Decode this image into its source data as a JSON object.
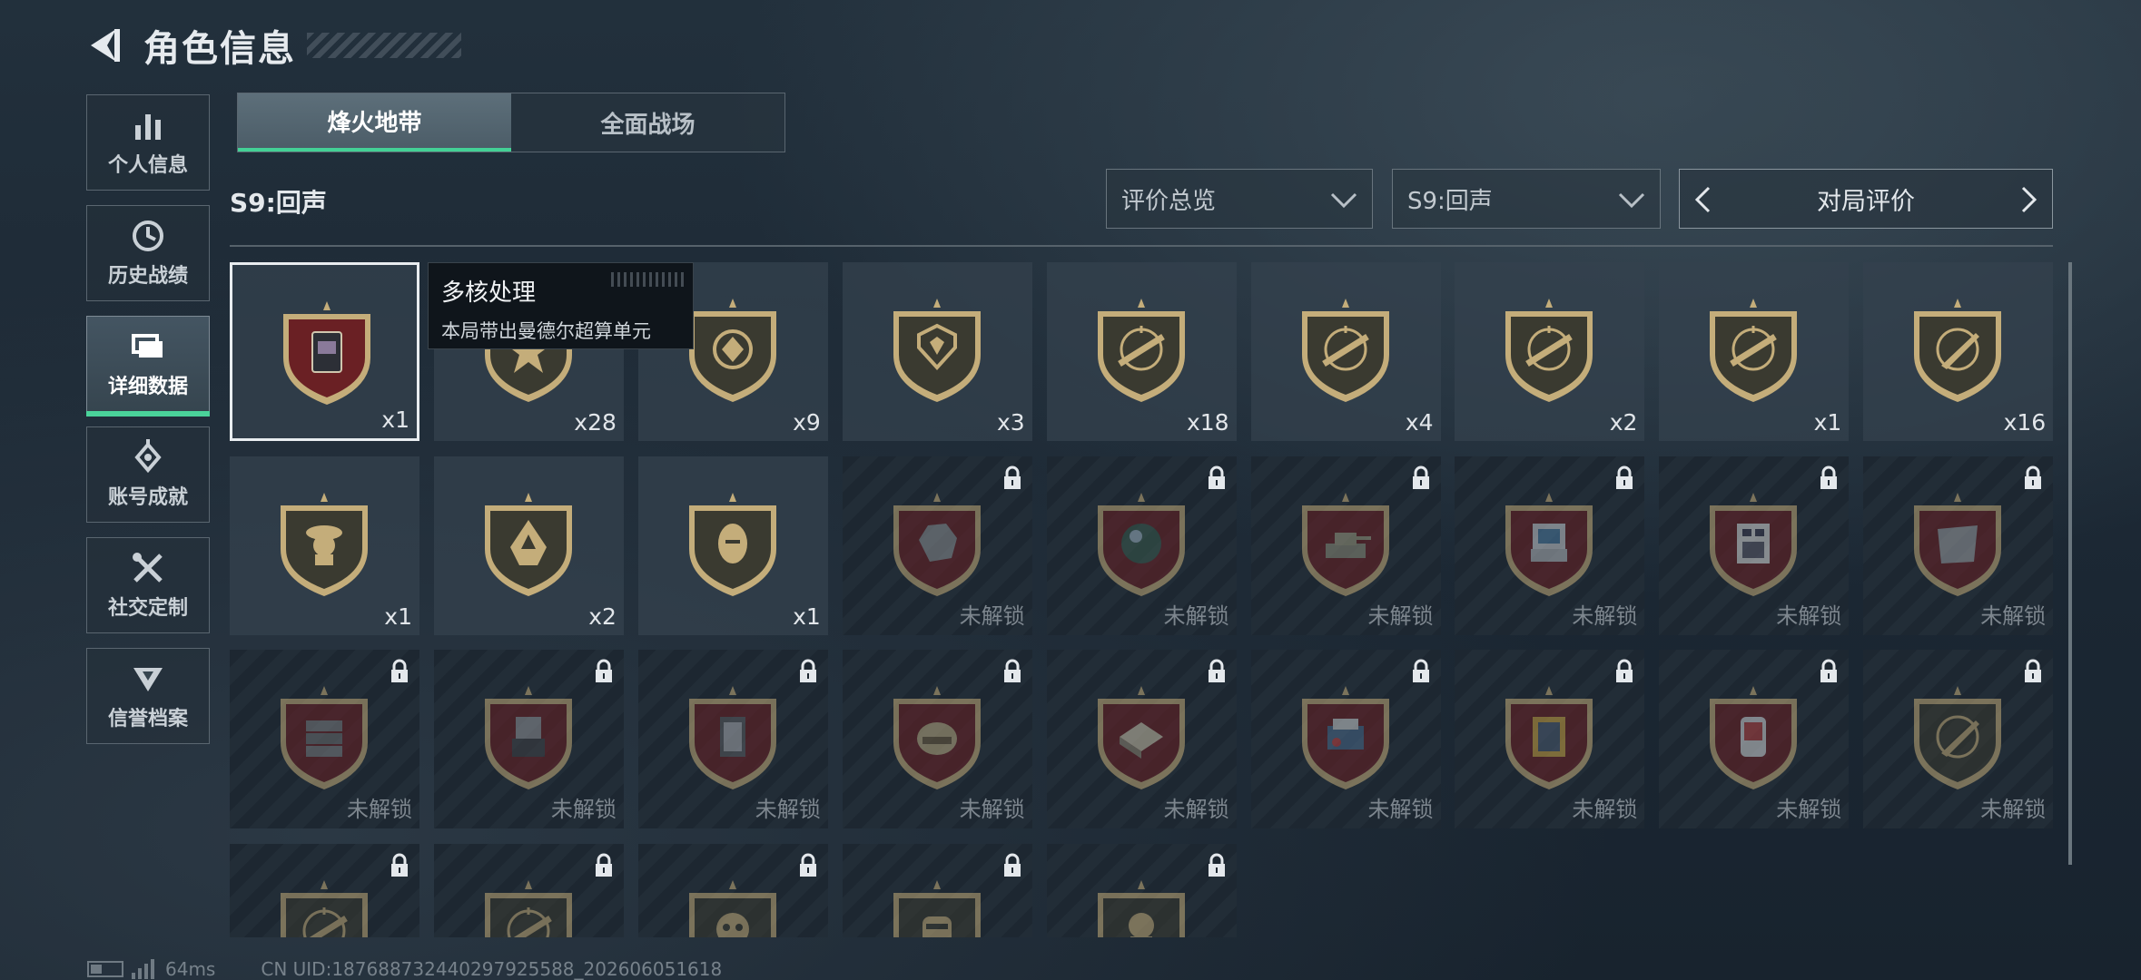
{
  "header": {
    "title": "角色信息"
  },
  "sidebar": {
    "items": [
      {
        "label": "个人信息",
        "icon": "bar-chart-icon",
        "active": false
      },
      {
        "label": "历史战绩",
        "icon": "clock-icon",
        "active": false
      },
      {
        "label": "详细数据",
        "icon": "cards-icon",
        "active": true
      },
      {
        "label": "账号成就",
        "icon": "achievement-icon",
        "active": false
      },
      {
        "label": "社交定制",
        "icon": "tools-icon",
        "active": false
      },
      {
        "label": "信誉档案",
        "icon": "reputation-icon",
        "active": false
      }
    ]
  },
  "tabs": [
    {
      "label": "烽火地带",
      "active": true
    },
    {
      "label": "全面战场",
      "active": false
    }
  ],
  "season_label": "S9:回声",
  "filters": {
    "overview": "评价总览",
    "season": "S9:回声",
    "pager_label": "对局评价"
  },
  "tooltip": {
    "title": "多核处理",
    "desc": "本局带出曼德尔超算单元"
  },
  "locked_label": "未解锁",
  "badges": [
    {
      "type": "computer",
      "count": "x1",
      "locked": false,
      "selected": true
    },
    {
      "type": "star",
      "count": "x28",
      "locked": false
    },
    {
      "type": "emblem",
      "count": "x9",
      "locked": false
    },
    {
      "type": "chevron",
      "count": "x3",
      "locked": false
    },
    {
      "type": "rifle",
      "count": "x18",
      "locked": false
    },
    {
      "type": "rifle",
      "count": "x4",
      "locked": false
    },
    {
      "type": "rifle",
      "count": "x2",
      "locked": false
    },
    {
      "type": "rifle",
      "count": "x1",
      "locked": false
    },
    {
      "type": "knife",
      "count": "x16",
      "locked": false
    },
    {
      "type": "soldier",
      "count": "x1",
      "locked": false
    },
    {
      "type": "hood",
      "count": "x2",
      "locked": false
    },
    {
      "type": "face",
      "count": "x1",
      "locked": false
    },
    {
      "type": "rock",
      "locked": true
    },
    {
      "type": "orb",
      "locked": true
    },
    {
      "type": "tank",
      "locked": true
    },
    {
      "type": "machine",
      "locked": true
    },
    {
      "type": "board",
      "locked": true
    },
    {
      "type": "plate",
      "locked": true
    },
    {
      "type": "crate",
      "locked": true
    },
    {
      "type": "server",
      "locked": true
    },
    {
      "type": "reactor",
      "locked": true
    },
    {
      "type": "helmet",
      "locked": true
    },
    {
      "type": "chess",
      "locked": true
    },
    {
      "type": "device",
      "locked": true
    },
    {
      "type": "frame",
      "locked": true
    },
    {
      "type": "capsule",
      "locked": true
    },
    {
      "type": "knife",
      "locked": true
    },
    {
      "type": "rifle",
      "locked": true
    },
    {
      "type": "rifle",
      "locked": true
    },
    {
      "type": "skull",
      "locked": true
    },
    {
      "type": "mask",
      "locked": true
    },
    {
      "type": "head",
      "locked": true
    }
  ],
  "footer": {
    "ping": "64ms",
    "uid": "CN UID:18768873244029792558​8_202606051618"
  }
}
